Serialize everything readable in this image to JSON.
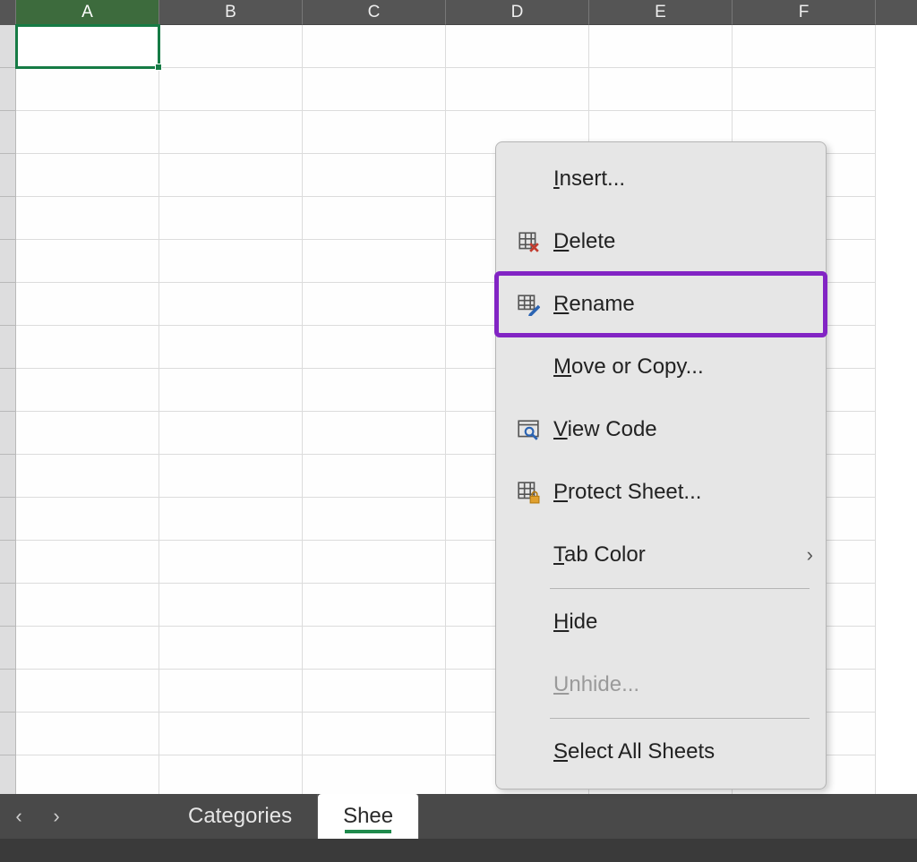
{
  "columns": [
    "A",
    "B",
    "C",
    "D",
    "E",
    "F"
  ],
  "selected_column_index": 0,
  "selected_cell": {
    "row": 0,
    "col": 0
  },
  "visible_rows": 18,
  "sheet_tabs": {
    "prev_label": "‹",
    "next_label": "›",
    "items": [
      {
        "label": "Categories",
        "active": false
      },
      {
        "label": "Shee",
        "active": true
      }
    ]
  },
  "context_menu": {
    "items": [
      {
        "id": "insert",
        "label": "Insert...",
        "underline_char": "I",
        "icon": ""
      },
      {
        "id": "delete",
        "label": "Delete",
        "underline_char": "D",
        "icon": "delete"
      },
      {
        "id": "rename",
        "label": "Rename",
        "underline_char": "R",
        "icon": "rename",
        "highlight": true
      },
      {
        "id": "move",
        "label": "Move or Copy...",
        "underline_char": "M",
        "icon": ""
      },
      {
        "id": "viewcode",
        "label": "View Code",
        "underline_char": "V",
        "icon": "viewcode"
      },
      {
        "id": "protect",
        "label": "Protect Sheet...",
        "underline_char": "P",
        "icon": "protect"
      },
      {
        "id": "tabcolor",
        "label": "Tab Color",
        "underline_char": "T",
        "icon": "",
        "submenu": true
      },
      {
        "separator": true
      },
      {
        "id": "hide",
        "label": "Hide",
        "underline_char": "H",
        "icon": ""
      },
      {
        "id": "unhide",
        "label": "Unhide...",
        "underline_char": "U",
        "icon": "",
        "disabled": true
      },
      {
        "separator": true
      },
      {
        "id": "selectall",
        "label": "Select All Sheets",
        "underline_char": "S",
        "icon": ""
      }
    ]
  }
}
